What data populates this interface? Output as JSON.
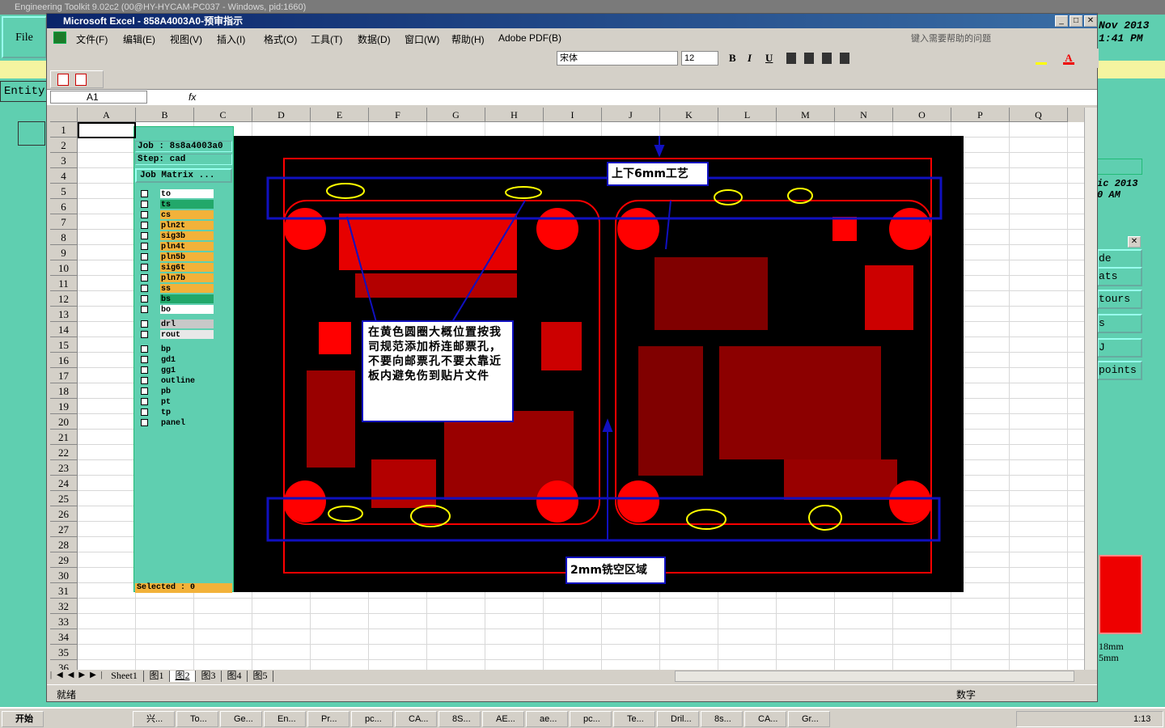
{
  "background_app": {
    "title": "Engineering Toolkit 9.02c2 (00@HY-HYCAM-PC037 - Windows, pid:1660)",
    "file_label": "File",
    "entity_label": "Entity",
    "clock_top": "Nov 2013\n1:41 PM",
    "clock_mid": "ic 2013\n0 AM",
    "right_panel_items": [
      "de",
      "ats",
      "tours",
      "s",
      "J",
      "points"
    ],
    "right_units": "18mm\n5mm"
  },
  "excel": {
    "title": "Microsoft Excel - 858A4003A0-预审指示",
    "menus": [
      "文件(F)",
      "编辑(E)",
      "视图(V)",
      "插入(I)",
      "格式(O)",
      "工具(T)",
      "数据(D)",
      "窗口(W)",
      "帮助(H)",
      "Adobe PDF(B)"
    ],
    "help_placeholder": "键入需要帮助的问题",
    "font_name": "宋体",
    "font_size": "12",
    "toolbar_buttons": [
      "B",
      "I",
      "U"
    ],
    "name_box": "A1",
    "fx": "fx",
    "columns": [
      "A",
      "B",
      "C",
      "D",
      "E",
      "F",
      "G",
      "H",
      "I",
      "J",
      "K",
      "L",
      "M",
      "N",
      "O",
      "P",
      "Q"
    ],
    "rows": [
      "1",
      "2",
      "3",
      "4",
      "5",
      "6",
      "7",
      "8",
      "9",
      "10",
      "11",
      "12",
      "13",
      "14",
      "15",
      "16",
      "17",
      "18",
      "19",
      "20",
      "21",
      "22",
      "23",
      "24",
      "25",
      "26",
      "27",
      "28",
      "29",
      "30",
      "31",
      "32",
      "33",
      "34",
      "35",
      "36"
    ],
    "sheet_tabs": [
      "Sheet1",
      "图1",
      "图2",
      "图3",
      "图4",
      "图5"
    ],
    "active_sheet": "图2",
    "status_left": "就绪",
    "status_right": "数字"
  },
  "job_panel": {
    "job": "Job : 8s8a4003a0",
    "step": "Step: cad",
    "matrix_btn": "Job Matrix ...",
    "selected": "Selected : 0",
    "layers": [
      {
        "name": "to",
        "color": "#ffffff"
      },
      {
        "name": "ts",
        "color": "#22a86a"
      },
      {
        "name": "cs",
        "color": "#f2b23a"
      },
      {
        "name": "pln2t",
        "color": "#f2b23a"
      },
      {
        "name": "sig3b",
        "color": "#f2b23a"
      },
      {
        "name": "pln4t",
        "color": "#f2b23a"
      },
      {
        "name": "pln5b",
        "color": "#f2b23a"
      },
      {
        "name": "sig6t",
        "color": "#f2b23a"
      },
      {
        "name": "pln7b",
        "color": "#f2b23a"
      },
      {
        "name": "ss",
        "color": "#f2b23a"
      },
      {
        "name": "bs",
        "color": "#22a86a"
      },
      {
        "name": "bo",
        "color": "#ffffff"
      },
      {
        "name": "drl",
        "color": "#c8c8c8"
      },
      {
        "name": "rout",
        "color": "#e8e8e8"
      },
      {
        "name": "bp",
        "color": "#5fcfb0"
      },
      {
        "name": "gd1",
        "color": "#5fcfb0"
      },
      {
        "name": "gg1",
        "color": "#5fcfb0"
      },
      {
        "name": "outline",
        "color": "#5fcfb0"
      },
      {
        "name": "pb",
        "color": "#5fcfb0"
      },
      {
        "name": "pt",
        "color": "#5fcfb0"
      },
      {
        "name": "tp",
        "color": "#5fcfb0"
      },
      {
        "name": "panel",
        "color": "#5fcfb0"
      }
    ]
  },
  "annotations": {
    "top_label": "上下6mm工艺",
    "bottom_label": "2mm铣空区域",
    "note": "在黄色圆圈大概位置按我司规范添加桥连邮票孔，不要向邮票孔不要太靠近板内避免伤到贴片文件"
  },
  "taskbar": {
    "start": "开始",
    "items": [
      "兴...",
      "To...",
      "Ge...",
      "En...",
      "Pr...",
      "pc...",
      "CA...",
      "8S...",
      "AE...",
      "ae...",
      "pc...",
      "Te...",
      "Dril...",
      "8s...",
      "CA...",
      "Gr..."
    ],
    "time": "1:13"
  },
  "colors": {
    "pcb_copper": "#ff0000",
    "annotation_blue": "#1010c0",
    "circle_yellow": "#ffff00",
    "title_blue": "#0a246a"
  }
}
